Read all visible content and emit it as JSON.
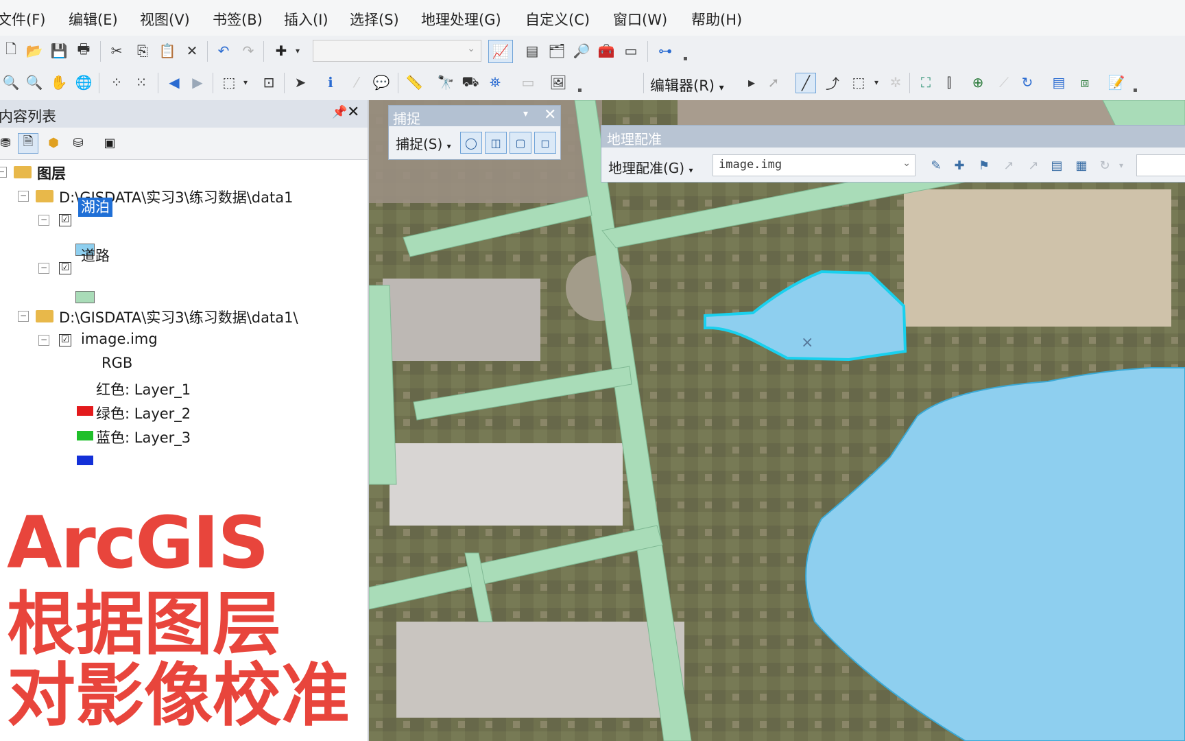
{
  "menu": [
    "文件(F)",
    "编辑(E)",
    "视图(V)",
    "书签(B)",
    "插入(I)",
    "选择(S)",
    "地理处理(G)",
    "自定义(C)",
    "窗口(W)",
    "帮助(H)"
  ],
  "toolbar": {
    "editor_label": "编辑器(R)",
    "editor_dropdown": "▾"
  },
  "toc": {
    "title": "内容列表",
    "pin": "📌",
    "close": "✕",
    "root_label": "图层",
    "group1_path": "D:\\GISDATA\\实习3\\练习数据\\data1",
    "layer_lake": "湖泊",
    "layer_road": "道路",
    "group2_path": "D:\\GISDATA\\实习3\\练习数据\\data1\\",
    "layer_image": "image.img",
    "rgb_label": "RGB",
    "band_red": "红色:    Layer_1",
    "band_green": "绿色: Layer_2",
    "band_blue": "蓝色:    Layer_3",
    "colors": {
      "lake": "#8ecfef",
      "road": "#a9dcb8",
      "red": "#e31a1c",
      "green": "#1fbf2a",
      "blue": "#1330d8"
    }
  },
  "overlay": {
    "line1": "ArcGIS",
    "line2": "根据图层",
    "line3": "对影像校准",
    "color": "#e8453c"
  },
  "snapping": {
    "title": "捕捉",
    "menu": "捕捉(S)",
    "dropdown": "▾",
    "close": "✕"
  },
  "georef": {
    "title": "地理配准",
    "menu": "地理配准(G)",
    "layer_value": "image.img"
  },
  "map_colors": {
    "lake": "#8ecfef",
    "lake_selected_outline": "#19d0ee",
    "road": "#a9dcb8"
  }
}
